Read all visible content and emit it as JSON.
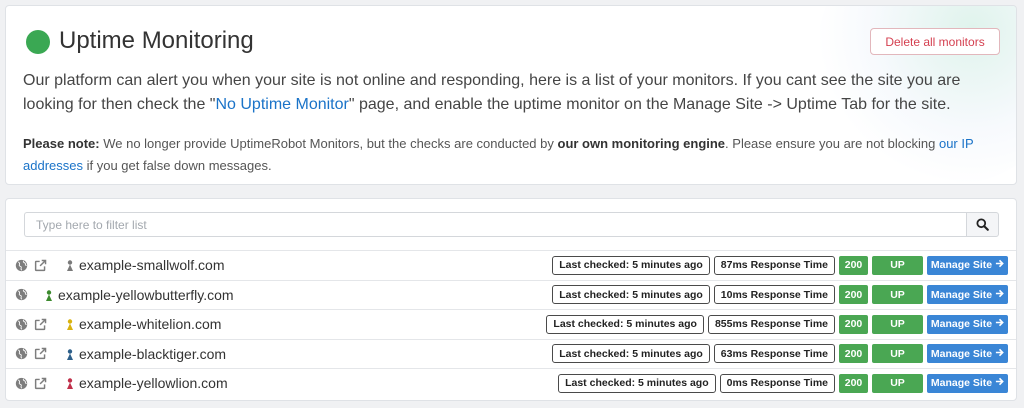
{
  "header": {
    "title": "Uptime Monitoring",
    "delete_label": "Delete all monitors",
    "status_color": "#3aa853",
    "intro_before": "Our platform can alert you when your site is not online and responding, here is a list of your monitors. If you cant see the site you are looking for then check the \"",
    "intro_link": "No Uptime Monitor",
    "intro_after": "\" page, and enable the uptime monitor on the Manage Site -> Uptime Tab for the site.",
    "note_label": "Please note:",
    "note_text_1": " We no longer provide UptimeRobot Monitors, but the checks are conducted by ",
    "note_bold": "our own monitoring engine",
    "note_text_2": ". Please ensure you are not blocking ",
    "note_link": "our IP addresses",
    "note_text_3": " if you get false down messages."
  },
  "filter": {
    "placeholder": "Type here to filter list"
  },
  "monitors": [
    {
      "site": "example-smallwolf.com",
      "icon": "smallwolf-favicon",
      "icon_color": "#7a7a7a",
      "external_link": true,
      "last_checked": "Last checked: 5 minutes ago",
      "response": "87ms Response Time",
      "code": "200",
      "status": "UP",
      "manage": "Manage Site"
    },
    {
      "site": "example-yellowbutterfly.com",
      "icon": "yellowbutterfly-favicon",
      "icon_color": "#3c8a2e",
      "external_link": false,
      "last_checked": "Last checked: 5 minutes ago",
      "response": "10ms Response Time",
      "code": "200",
      "status": "UP",
      "manage": "Manage Site"
    },
    {
      "site": "example-whitelion.com",
      "icon": "whitelion-favicon",
      "icon_color": "#d9b20f",
      "external_link": true,
      "last_checked": "Last checked: 5 minutes ago",
      "response": "855ms Response Time",
      "code": "200",
      "status": "UP",
      "manage": "Manage Site"
    },
    {
      "site": "example-blacktiger.com",
      "icon": "blacktiger-favicon",
      "icon_color": "#2d5f8a",
      "external_link": true,
      "last_checked": "Last checked: 5 minutes ago",
      "response": "63ms Response Time",
      "code": "200",
      "status": "UP",
      "manage": "Manage Site"
    },
    {
      "site": "example-yellowlion.com",
      "icon": "yellowlion-favicon",
      "icon_color": "#c0304a",
      "external_link": true,
      "last_checked": "Last checked: 5 minutes ago",
      "response": "0ms Response Time",
      "code": "200",
      "status": "UP",
      "manage": "Manage Site"
    }
  ],
  "colors": {
    "accent_blue": "#3a86d6",
    "status_green": "#4aa753",
    "danger": "#d43f4f"
  }
}
